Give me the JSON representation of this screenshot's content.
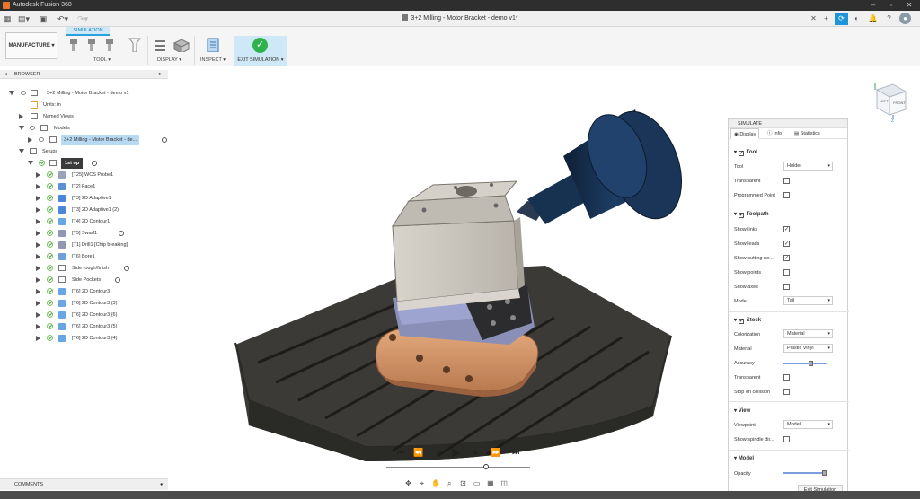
{
  "window": {
    "title": "Autodesk Fusion 360"
  },
  "qat": {
    "document_title": "3+2 Milling - Motor Bracket - demo v1*"
  },
  "ribbon": {
    "workspace": "MANUFACTURE",
    "simulation_tab": "SIMULATION",
    "groups": {
      "tool": "TOOL",
      "display": "DISPLAY",
      "inspect": "INSPECT",
      "exit": "EXIT SIMULATION"
    }
  },
  "browser": {
    "header": "BROWSER",
    "root": "3+2 Milling - Motor Bracket - demo v1",
    "units": "Units: in",
    "named_views": "Named Views",
    "models": "Models",
    "model_item": "3+2 Milling - Motor Bracket - de...",
    "setups": "Setups",
    "setup": "1st op",
    "operations": [
      {
        "label": "[T25] WCS Probe1",
        "color": "#9aa2b8"
      },
      {
        "label": "[T2] Face1",
        "color": "#5d8fd6"
      },
      {
        "label": "[T3] 2D Adaptive1",
        "color": "#4c86d8"
      },
      {
        "label": "[T3] 2D Adaptive1 (2)",
        "color": "#4c86d8"
      },
      {
        "label": "[T4] 2D Contour1",
        "color": "#6aa6e6"
      },
      {
        "label": "[T5] Swarf1",
        "color": "#8f98b0"
      },
      {
        "label": "[T1] Drill1 [Chip breaking]",
        "color": "#8f98b0"
      },
      {
        "label": "[T6] Bore1",
        "color": "#6d9fe0"
      },
      {
        "label": "Side rough/finish",
        "color": "folder"
      },
      {
        "label": "Side Pockets",
        "color": "folder"
      },
      {
        "label": "[T6] 2D Contour3",
        "color": "#6aa6e6"
      },
      {
        "label": "[T6] 2D Contour3 (3)",
        "color": "#6aa6e6"
      },
      {
        "label": "[T6] 2D Contour3 (6)",
        "color": "#6aa6e6"
      },
      {
        "label": "[T6] 2D Contour3 (5)",
        "color": "#6aa6e6"
      },
      {
        "label": "[T6] 2D Contour3 (4)",
        "color": "#6aa6e6"
      }
    ]
  },
  "comments": {
    "label": "COMMENTS"
  },
  "viewcube": {
    "left": "LEFT",
    "front": "FRONT",
    "axis_z": "Z"
  },
  "simulate": {
    "header": "SIMULATE",
    "tabs": {
      "display": "Display",
      "info": "Info",
      "statistics": "Statistics"
    },
    "tool": {
      "section": "Tool",
      "tool_label": "Tool",
      "tool_value": "Holder",
      "transparent": "Transparent",
      "programmed_point": "Programmed Point"
    },
    "toolpath": {
      "section": "Toolpath",
      "show_links": "Show links",
      "show_leads": "Show leads",
      "show_cutting": "Show cutting no...",
      "show_points": "Show points",
      "show_axes": "Show axes",
      "mode": "Mode",
      "mode_value": "Tail"
    },
    "stock": {
      "section": "Stock",
      "colorization": "Colorization",
      "colorization_value": "Material",
      "material": "Material",
      "material_value": "Plastic Vinyl",
      "accuracy": "Accuracy",
      "accuracy_level": 0.65,
      "transparent": "Transparent",
      "stop_on_collision": "Stop on collision"
    },
    "view": {
      "section": "View",
      "viewpoint": "Viewpoint",
      "viewpoint_value": "Model",
      "show_spindle": "Show spindle dir..."
    },
    "model": {
      "section": "Model",
      "opacity": "Opacity",
      "opacity_level": 1.0
    }
  },
  "exit_button": "Exit Simulation",
  "playback": {
    "position": 0.7
  }
}
